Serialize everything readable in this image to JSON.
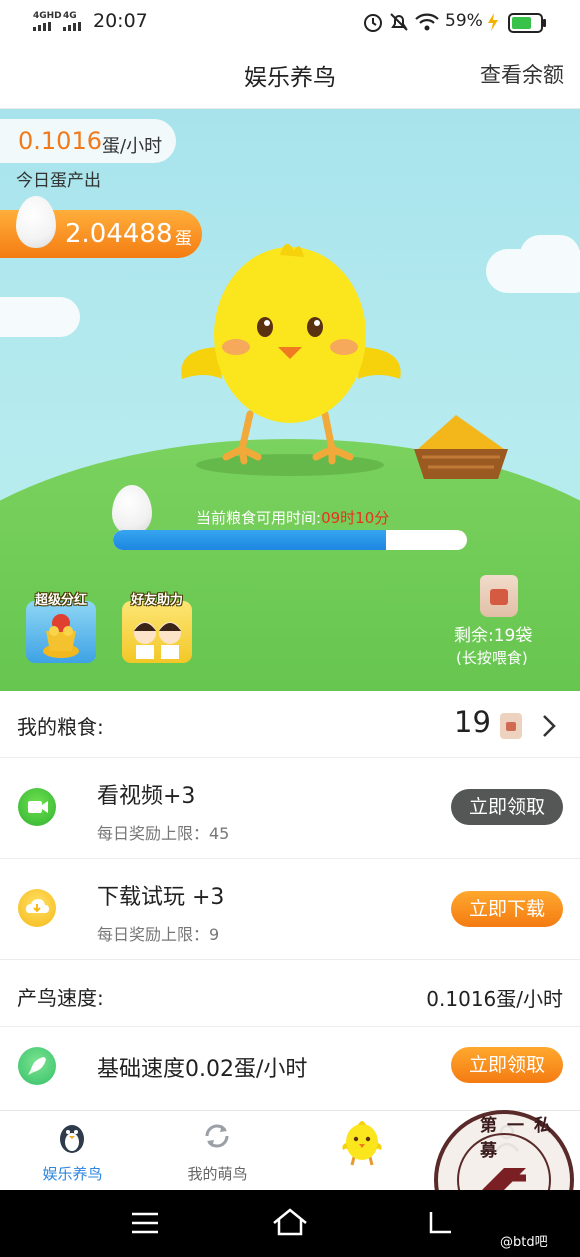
{
  "status_bar": {
    "net1": "4GHD",
    "net2": "4G",
    "time": "20:07",
    "battery_percent": "59%"
  },
  "header": {
    "title": "娱乐养鸟",
    "right_link": "查看余额"
  },
  "scene": {
    "rate_value": "0.1016",
    "rate_unit": "蛋/小时",
    "today_label": "今日蛋产出",
    "egg_total": "2.04488",
    "egg_unit": "蛋",
    "food_time_label": "当前粮食可用时间:",
    "food_time_value": "09时10分",
    "food_progress": 0.77,
    "badge_left": "超级分红",
    "badge_right": "好友助力",
    "remain_label": "剩余:19袋",
    "remain_hint": "(长按喂食)"
  },
  "my_food": {
    "label": "我的粮食:",
    "count": "19"
  },
  "tasks": [
    {
      "title": "看视频+3",
      "sub": "每日奖励上限：45",
      "button": "立即领取",
      "icon": "video-icon"
    },
    {
      "title": "下载试玩 +3",
      "sub": "每日奖励上限：9",
      "button": "立即下载",
      "icon": "download-icon"
    }
  ],
  "speed": {
    "label": "产鸟速度:",
    "value": "0.1016蛋/小时",
    "base_title": "基础速度0.02蛋/小时",
    "base_button": "立即领取"
  },
  "tabbar": {
    "tabs": [
      {
        "label": "娱乐养鸟",
        "icon": "penguin-icon"
      },
      {
        "label": "我的萌鸟",
        "icon": "refresh-icon"
      },
      {
        "label": "",
        "icon": "chick-icon"
      },
      {
        "label": "",
        "icon": "profile-icon"
      }
    ]
  },
  "watermark": {
    "text": "第一私募",
    "corner": "@btd吧"
  },
  "colors": {
    "accent_orange": "#f47b12",
    "highlight_red": "#e8321f",
    "progress_blue": "#1d86e0",
    "tab_active": "#2e86de"
  }
}
